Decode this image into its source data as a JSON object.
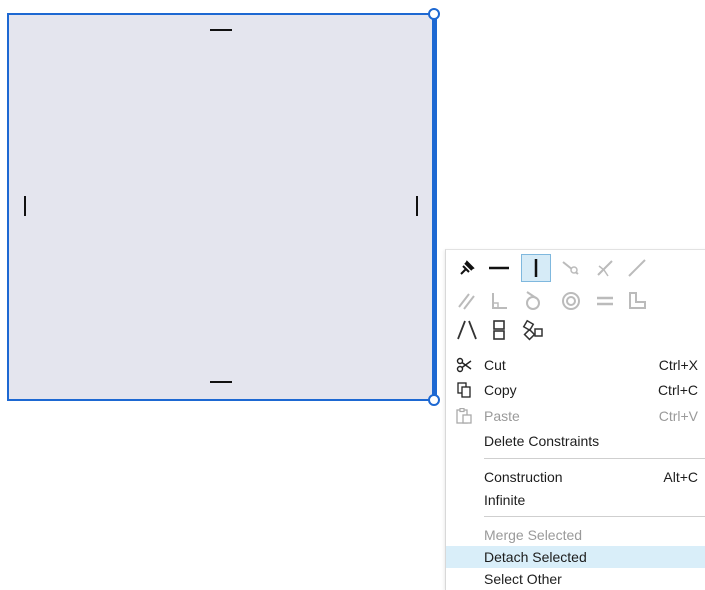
{
  "sketch": {
    "accent_color": "#1d68d2",
    "fill_color": "#e4e5ee",
    "constraint_marks": [
      "horizontal-top",
      "horizontal-bottom",
      "vertical-left",
      "vertical-right"
    ]
  },
  "context_menu": {
    "constraint_icons": [
      {
        "name": "fix-icon",
        "enabled": true
      },
      {
        "name": "horizontal-icon",
        "enabled": true
      },
      {
        "name": "vertical-icon",
        "enabled": true,
        "active": true
      },
      {
        "name": "coincident-icon",
        "enabled": false
      },
      {
        "name": "midpoint-icon",
        "enabled": false
      },
      {
        "name": "collinear-icon",
        "enabled": false
      },
      {
        "name": "parallel-icon",
        "enabled": false
      },
      {
        "name": "perpendicular-icon",
        "enabled": false
      },
      {
        "name": "tangent-icon",
        "enabled": false
      },
      {
        "name": "concentric-icon",
        "enabled": false
      },
      {
        "name": "equal-icon",
        "enabled": false
      },
      {
        "name": "smooth-icon",
        "enabled": false
      },
      {
        "name": "symmetry-icon",
        "enabled": true
      },
      {
        "name": "stack-icon",
        "enabled": true
      },
      {
        "name": "pattern-icon",
        "enabled": true
      }
    ],
    "items": {
      "cut": {
        "label": "Cut",
        "shortcut": "Ctrl+X",
        "icon": "scissors-icon"
      },
      "copy": {
        "label": "Copy",
        "shortcut": "Ctrl+C",
        "icon": "copy-icon"
      },
      "paste": {
        "label": "Paste",
        "shortcut": "Ctrl+V",
        "icon": "paste-icon",
        "disabled": true
      },
      "delete_constraints": {
        "label": "Delete Constraints"
      },
      "construction": {
        "label": "Construction",
        "shortcut": "Alt+C"
      },
      "infinite": {
        "label": "Infinite"
      },
      "merge_selected": {
        "label": "Merge Selected",
        "disabled": true
      },
      "detach_selected": {
        "label": "Detach Selected",
        "highlighted": true
      },
      "select_other": {
        "label": "Select Other"
      }
    },
    "highlight_color": "#d9eef9"
  }
}
